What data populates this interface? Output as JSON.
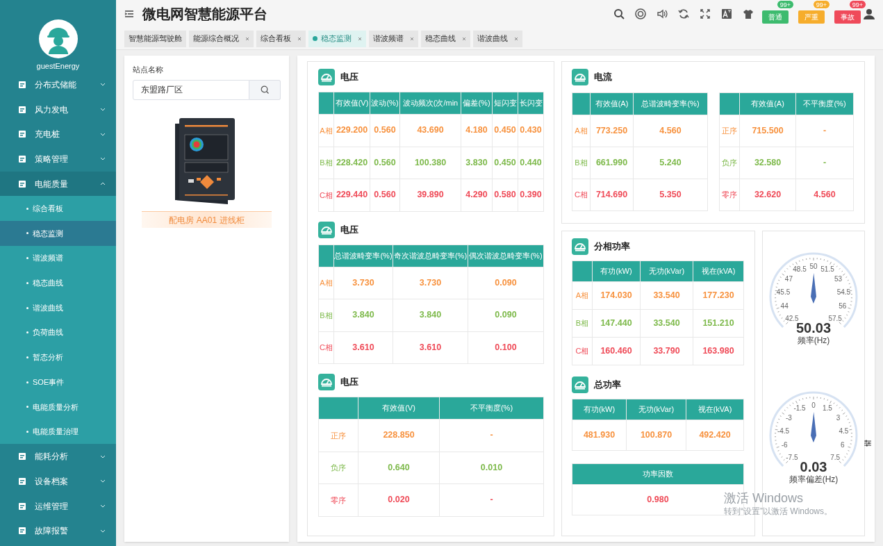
{
  "header": {
    "title": "微电网智慧能源平台",
    "alerts": [
      {
        "label": "普通",
        "count": "99+",
        "color": "#3dbb6e"
      },
      {
        "label": "严重",
        "count": "99+",
        "color": "#f6ad2c"
      },
      {
        "label": "事故",
        "count": "99+",
        "color": "#ef4a5a"
      }
    ]
  },
  "tabs": [
    {
      "label": "智慧能源驾驶舱",
      "closable": false,
      "selected": false
    },
    {
      "label": "能源综合概况",
      "closable": true,
      "selected": false
    },
    {
      "label": "综合看板",
      "closable": true,
      "selected": false
    },
    {
      "label": "稳态监测",
      "closable": true,
      "selected": true
    },
    {
      "label": "谐波频谱",
      "closable": true,
      "selected": false
    },
    {
      "label": "稳态曲线",
      "closable": true,
      "selected": false
    },
    {
      "label": "谐波曲线",
      "closable": true,
      "selected": false
    }
  ],
  "sidebar": {
    "user": "guestEnergy",
    "items": [
      {
        "label": "分布式储能",
        "expanded": false
      },
      {
        "label": "风力发电",
        "expanded": false
      },
      {
        "label": "充电桩",
        "expanded": false
      },
      {
        "label": "策略管理",
        "expanded": false
      },
      {
        "label": "电能质量",
        "expanded": true,
        "children": [
          {
            "label": "综合看板",
            "selected": false
          },
          {
            "label": "稳态监测",
            "selected": true
          },
          {
            "label": "谐波频谱",
            "selected": false
          },
          {
            "label": "稳态曲线",
            "selected": false
          },
          {
            "label": "谐波曲线",
            "selected": false
          },
          {
            "label": "负荷曲线",
            "selected": false
          },
          {
            "label": "暂态分析",
            "selected": false
          },
          {
            "label": "SOE事件",
            "selected": false
          },
          {
            "label": "电能质量分析",
            "selected": false
          },
          {
            "label": "电能质量治理",
            "selected": false
          }
        ]
      },
      {
        "label": "能耗分析",
        "expanded": false
      },
      {
        "label": "设备档案",
        "expanded": false
      },
      {
        "label": "运维管理",
        "expanded": false
      },
      {
        "label": "故障报警",
        "expanded": false
      }
    ]
  },
  "station": {
    "label": "站点名称",
    "value": "东盟路厂区",
    "device_caption": "配电房 AA01 进线柜"
  },
  "voltage_panels": [
    {
      "title": "电压",
      "row_headers": true,
      "columns": [
        "",
        "有效值(V)",
        "波动(%)",
        "波动频次(次/min",
        "偏差(%)",
        "短闪变",
        "长闪变"
      ],
      "rows": [
        {
          "color": "#f7913d",
          "cells": [
            "A相",
            "229.200",
            "0.560",
            "43.690",
            "4.180",
            "0.450",
            "0.430"
          ]
        },
        {
          "color": "#7db94a",
          "cells": [
            "B相",
            "228.420",
            "0.560",
            "100.380",
            "3.830",
            "0.450",
            "0.440"
          ]
        },
        {
          "color": "#ef4a57",
          "cells": [
            "C相",
            "229.440",
            "0.560",
            "39.890",
            "4.290",
            "0.580",
            "0.390"
          ]
        }
      ]
    },
    {
      "title": "电压",
      "row_headers": true,
      "columns": [
        "",
        "总谐波畸变率(%)",
        "奇次谐波总畸变率(%)",
        "偶次谐波总畸变率(%)"
      ],
      "rows": [
        {
          "color": "#f7913d",
          "cells": [
            "A相",
            "3.730",
            "3.730",
            "0.090"
          ]
        },
        {
          "color": "#7db94a",
          "cells": [
            "B相",
            "3.840",
            "3.840",
            "0.090"
          ]
        },
        {
          "color": "#ef4a57",
          "cells": [
            "C相",
            "3.610",
            "3.610",
            "0.100"
          ]
        }
      ]
    },
    {
      "title": "电压",
      "row_headers": true,
      "columns": [
        "",
        "有效值(V)",
        "不平衡度(%)"
      ],
      "rows": [
        {
          "color": "#f7913d",
          "cells": [
            "正序",
            "228.850",
            "-"
          ]
        },
        {
          "color": "#7db94a",
          "cells": [
            "负序",
            "0.640",
            "0.010"
          ]
        },
        {
          "color": "#ef4a57",
          "cells": [
            "零序",
            "0.020",
            "-"
          ]
        }
      ]
    }
  ],
  "current_panel": {
    "title": "电流",
    "tables": [
      {
        "row_headers": true,
        "columns": [
          "",
          "有效值(A)",
          "总谐波畸变率(%)"
        ],
        "rows": [
          {
            "color": "#f7913d",
            "cells": [
              "A相",
              "773.250",
              "4.560"
            ]
          },
          {
            "color": "#7db94a",
            "cells": [
              "B相",
              "661.990",
              "5.240"
            ]
          },
          {
            "color": "#ef4a57",
            "cells": [
              "C相",
              "714.690",
              "5.350"
            ]
          }
        ]
      },
      {
        "row_headers": true,
        "columns": [
          "",
          "有效值(A)",
          "不平衡度(%)"
        ],
        "rows": [
          {
            "color": "#f7913d",
            "cells": [
              "正序",
              "715.500",
              "-"
            ]
          },
          {
            "color": "#7db94a",
            "cells": [
              "负序",
              "32.580",
              "-"
            ]
          },
          {
            "color": "#ef4a57",
            "cells": [
              "零序",
              "32.620",
              "4.560"
            ]
          }
        ]
      }
    ]
  },
  "power_panels": [
    {
      "title": "分相功率",
      "tables": [
        {
          "row_headers": true,
          "columns": [
            "",
            "有功(kW)",
            "无功(kVar)",
            "视在(kVA)"
          ],
          "rows": [
            {
              "color": "#f7913d",
              "cells": [
                "A相",
                "174.030",
                "33.540",
                "177.230"
              ]
            },
            {
              "color": "#7db94a",
              "cells": [
                "B相",
                "147.440",
                "33.540",
                "151.210"
              ]
            },
            {
              "color": "#ef4a57",
              "cells": [
                "C相",
                "160.460",
                "33.790",
                "163.980"
              ]
            }
          ]
        }
      ]
    },
    {
      "title": "总功率",
      "tables": [
        {
          "row_headers": false,
          "columns": [
            "有功(kW)",
            "无功(kVar)",
            "视在(kVA)"
          ],
          "rows": [
            {
              "color": "#f7913d",
              "cells": [
                "481.930",
                "100.870",
                "492.420"
              ]
            }
          ]
        },
        {
          "row_headers": false,
          "columns": [
            "功率因数"
          ],
          "rows": [
            {
              "color": "#ef4a57",
              "cells": [
                "0.980"
              ]
            }
          ]
        }
      ]
    }
  ],
  "gauges": [
    {
      "value": "50.03",
      "label": "频率(Hz)",
      "level": 0.502,
      "ticks": [
        "50",
        "48.5",
        "51.5",
        "47",
        "53",
        "45.5",
        "54.5",
        "44",
        "56",
        "42.5",
        "57.5"
      ]
    },
    {
      "value": "0.03",
      "label": "频率偏差(Hz)",
      "level": 0.502,
      "ticks": [
        "0",
        "-1.5",
        "1.5",
        "-3",
        "3",
        "-4.5",
        "4.5",
        "-6",
        "6",
        "-7.5",
        "7.5"
      ]
    }
  ],
  "os_notice": {
    "title": "激活 Windows",
    "hint": "转到“设置”以激活 Windows。"
  }
}
